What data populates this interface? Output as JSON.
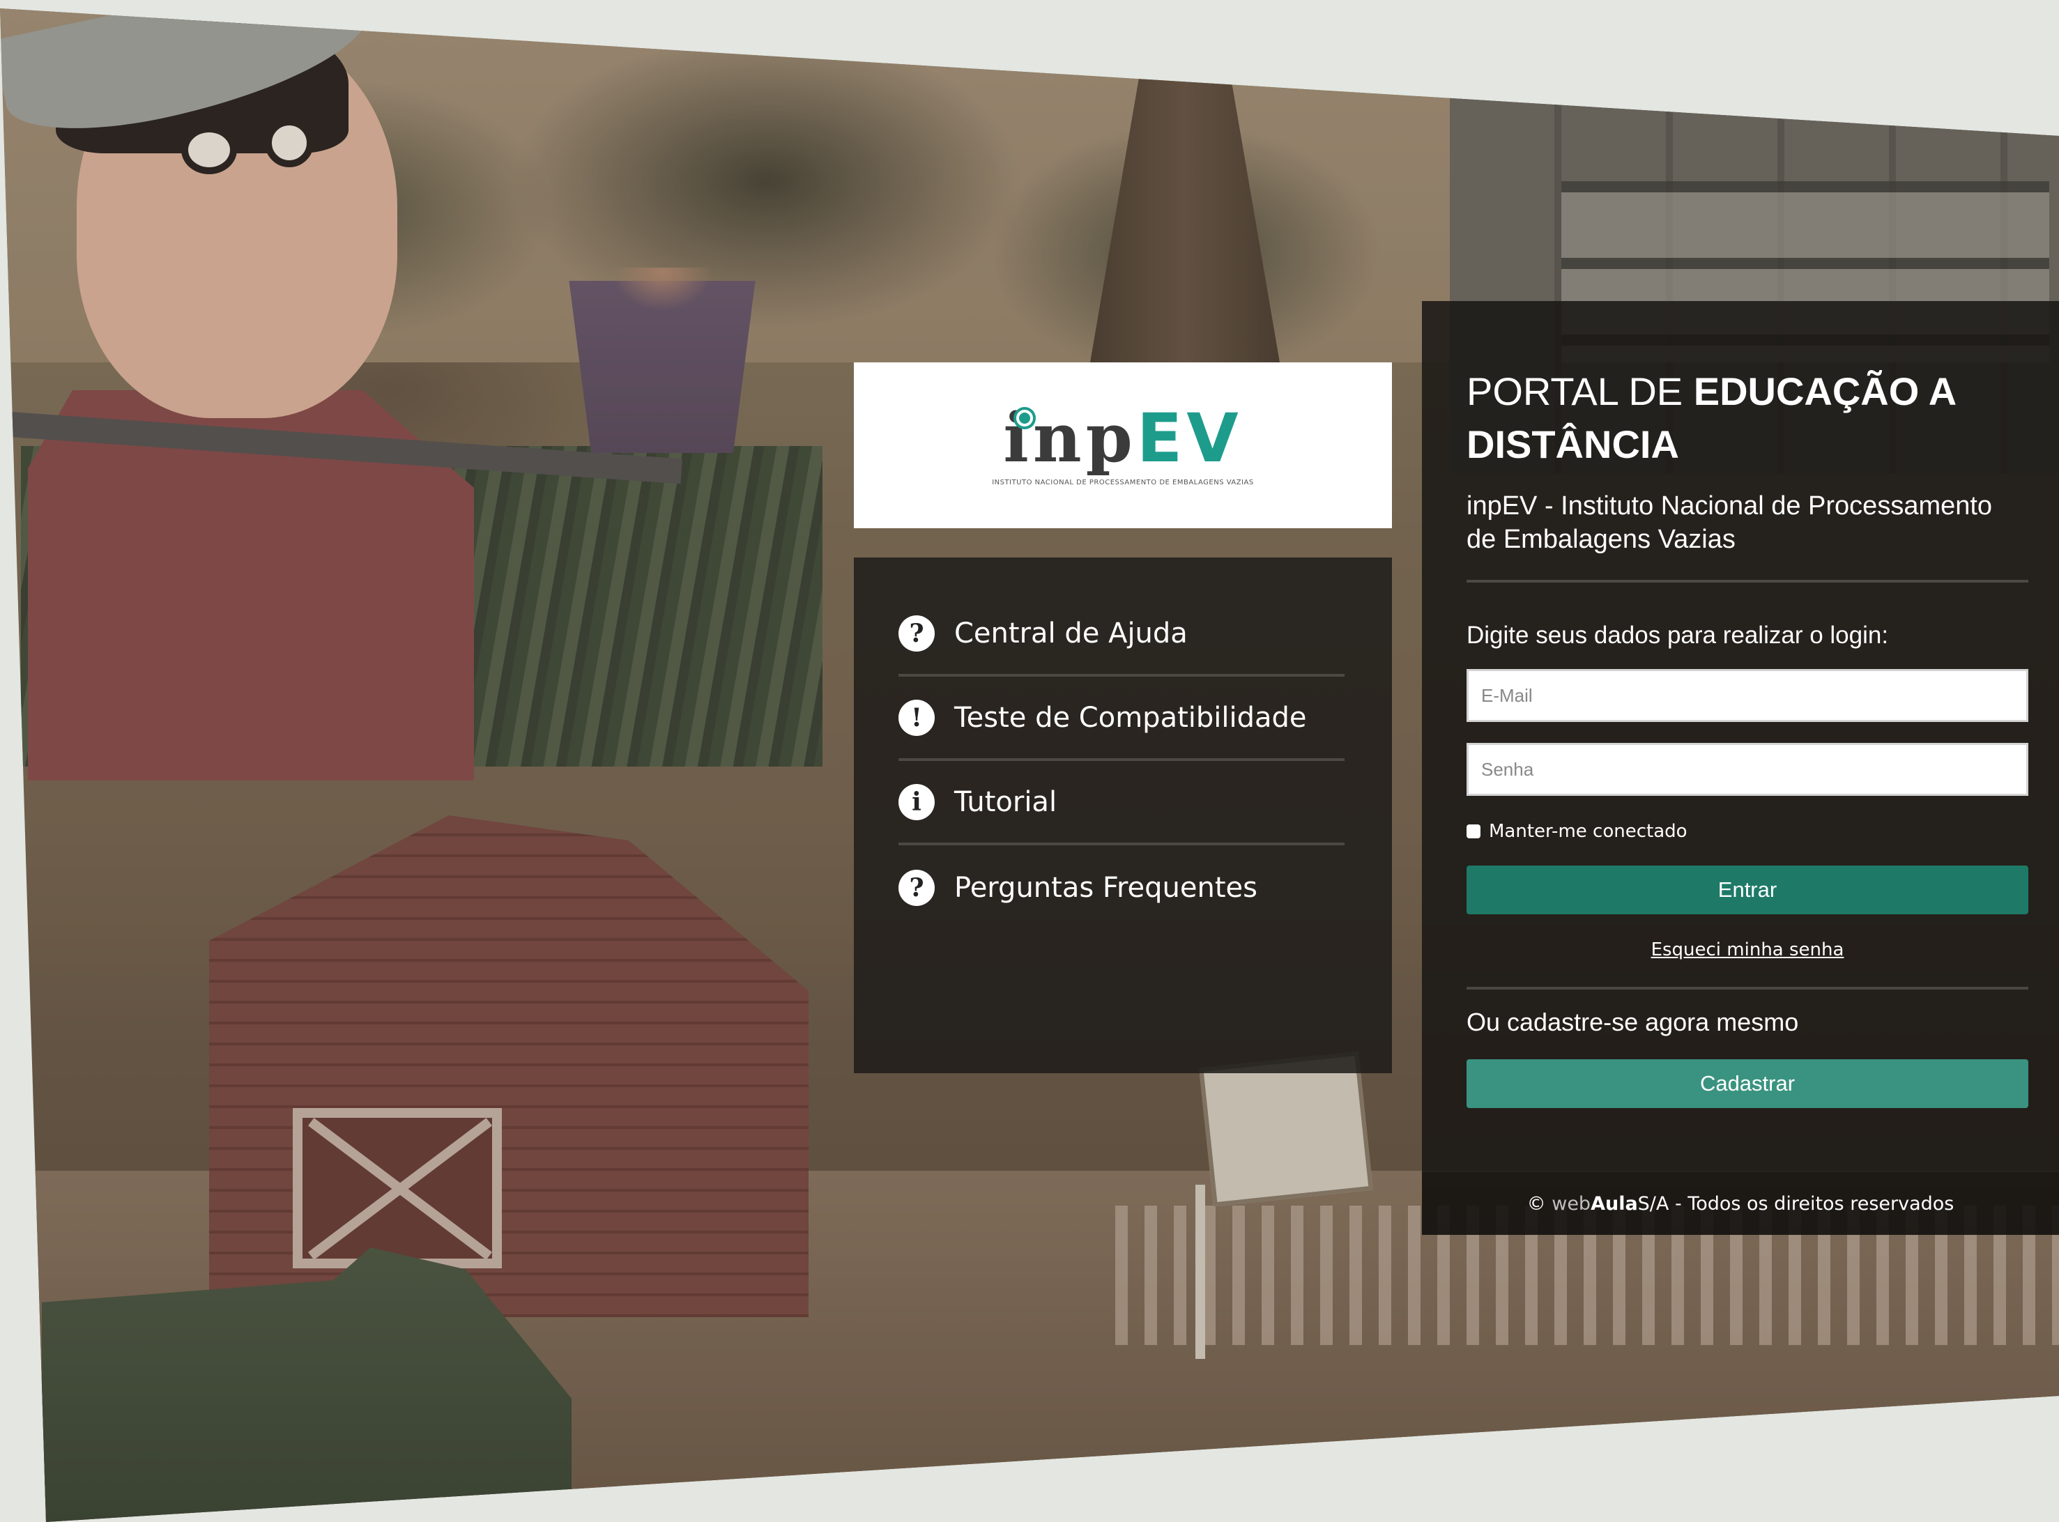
{
  "logo": {
    "brand_part1": "inp",
    "brand_part2": "EV",
    "tagline": "INSTITUTO NACIONAL DE PROCESSAMENTO DE EMBALAGENS VAZIAS"
  },
  "menu": {
    "items": [
      {
        "label": "Central de Ajuda",
        "icon": "question-icon",
        "glyph": "?"
      },
      {
        "label": "Teste de Compatibilidade",
        "icon": "exclamation-icon",
        "glyph": "!"
      },
      {
        "label": "Tutorial",
        "icon": "info-icon",
        "glyph": "i"
      },
      {
        "label": "Perguntas Frequentes",
        "icon": "question-icon",
        "glyph": "?"
      }
    ]
  },
  "login": {
    "title_light": "PORTAL DE ",
    "title_bold": "EDUCAÇÃO A DISTÂNCIA",
    "subtitle": "inpEV - Instituto Nacional de Processamento de Embalagens Vazias",
    "prompt": "Digite seus dados para realizar o login:",
    "email_placeholder": "E-Mail",
    "password_placeholder": "Senha",
    "remember_label": "Manter-me conectado",
    "submit_label": "Entrar",
    "forgot_label": "Esqueci minha senha",
    "register_prompt": "Ou cadastre-se agora mesmo",
    "register_label": "Cadastrar"
  },
  "footer": {
    "copyright_symbol": "©",
    "brand_light": "web",
    "brand_bold": "Aula",
    "rest": " S/A - Todos os direitos reservados"
  },
  "colors": {
    "accent": "#1e7a67",
    "accent_light": "#3a9380",
    "logo_teal": "#1d9c8c",
    "panel_dark": "#1e1c1a"
  }
}
